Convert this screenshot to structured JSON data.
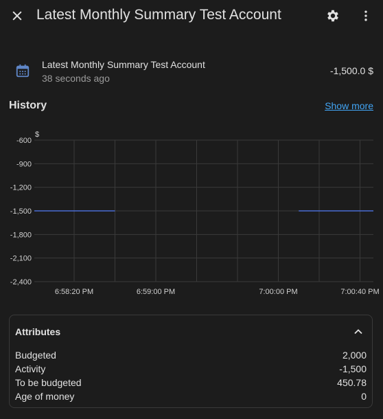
{
  "header": {
    "title": "Latest Monthly Summary Test Account",
    "close_icon": "close-icon",
    "settings_icon": "gear-icon",
    "more_icon": "more-vert-icon"
  },
  "entity": {
    "icon": "calendar-icon",
    "name": "Latest Monthly Summary Test Account",
    "last_changed": "38 seconds ago",
    "value": "-1,500.0 $"
  },
  "history": {
    "title": "History",
    "show_more": "Show more"
  },
  "chart_data": {
    "type": "line",
    "ylabel": "$",
    "ylim": [
      -2400,
      -600
    ],
    "y_ticks": [
      "-600",
      "-900",
      "-1,200",
      "-1,500",
      "-1,800",
      "-2,100",
      "-2,400"
    ],
    "x_ticks": [
      "6:58:20 PM",
      "6:59:00 PM",
      "7:00:00 PM",
      "7:00:40 PM"
    ],
    "series": [
      {
        "segments": [
          {
            "x": [
              "6:58:00 PM",
              "6:58:40 PM"
            ],
            "y": [
              -1500,
              -1500
            ]
          },
          {
            "x": [
              "7:00:10 PM",
              "7:00:50 PM"
            ],
            "y": [
              -1500,
              -1500
            ]
          }
        ]
      }
    ],
    "line_color": "#4a6cd4",
    "grid": true
  },
  "attributes": {
    "title": "Attributes",
    "chevron_icon": "chevron-up-icon",
    "rows": [
      {
        "label": "Budgeted",
        "value": "2,000"
      },
      {
        "label": "Activity",
        "value": "-1,500"
      },
      {
        "label": "To be budgeted",
        "value": "450.78"
      },
      {
        "label": "Age of money",
        "value": "0"
      }
    ]
  }
}
